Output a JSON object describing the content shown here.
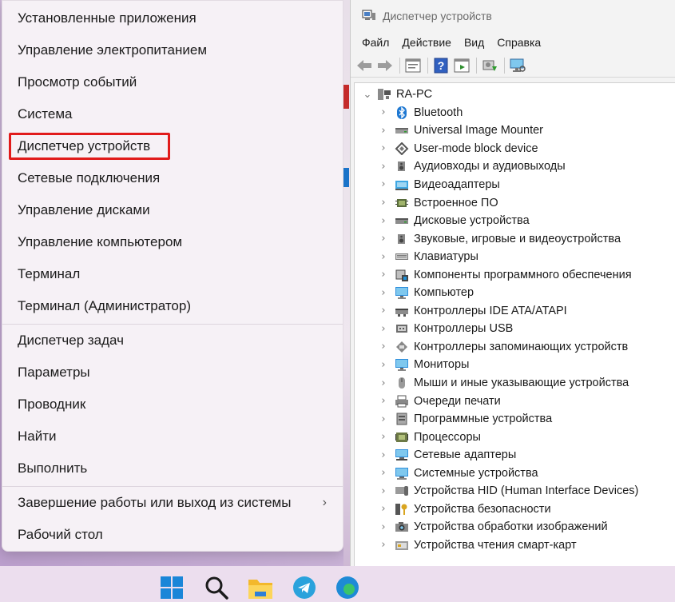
{
  "winx_menu": {
    "group1": [
      "Установленные приложения",
      "Управление электропитанием",
      "Просмотр событий",
      "Система",
      "Диспетчер устройств",
      "Сетевые подключения",
      "Управление дисками",
      "Управление компьютером",
      "Терминал",
      "Терминал (Администратор)"
    ],
    "group2": [
      "Диспетчер задач",
      "Параметры",
      "Проводник",
      "Найти",
      "Выполнить"
    ],
    "group3": [
      "Завершение работы или выход из системы",
      "Рабочий стол"
    ],
    "highlighted": "Диспетчер устройств",
    "submenu_glyph": "›",
    "highlight_color": "#e11b1b"
  },
  "device_manager": {
    "title": "Диспетчер устройств",
    "menus": [
      "Файл",
      "Действие",
      "Вид",
      "Справка"
    ],
    "toolbar_icons": [
      "back-arrow-icon",
      "forward-arrow-icon",
      "properties-icon",
      "help-icon",
      "view-icon",
      "update-driver-icon",
      "scan-hardware-icon"
    ],
    "root": "RA-PC",
    "expanded_glyph": "⌄",
    "collapsed_glyph": "›",
    "nodes": [
      {
        "label": "Bluetooth",
        "icon": "bluetooth-icon"
      },
      {
        "label": "Universal Image Mounter",
        "icon": "drive-icon"
      },
      {
        "label": "User-mode block device",
        "icon": "diamond-icon"
      },
      {
        "label": "Аудиовходы и аудиовыходы",
        "icon": "speaker-icon"
      },
      {
        "label": "Видеоадаптеры",
        "icon": "display-adapter-icon"
      },
      {
        "label": "Встроенное ПО",
        "icon": "chip-icon"
      },
      {
        "label": "Дисковые устройства",
        "icon": "disk-icon"
      },
      {
        "label": "Звуковые, игровые и видеоустройства",
        "icon": "speaker-icon"
      },
      {
        "label": "Клавиатуры",
        "icon": "keyboard-icon"
      },
      {
        "label": "Компоненты программного обеспечения",
        "icon": "software-component-icon"
      },
      {
        "label": "Компьютер",
        "icon": "monitor-icon"
      },
      {
        "label": "Контроллеры IDE ATA/ATAPI",
        "icon": "ide-icon"
      },
      {
        "label": "Контроллеры USB",
        "icon": "usb-icon"
      },
      {
        "label": "Контроллеры запоминающих устройств",
        "icon": "storage-controller-icon"
      },
      {
        "label": "Мониторы",
        "icon": "monitor-icon"
      },
      {
        "label": "Мыши и иные указывающие устройства",
        "icon": "mouse-icon"
      },
      {
        "label": "Очереди печати",
        "icon": "printer-icon"
      },
      {
        "label": "Программные устройства",
        "icon": "software-device-icon"
      },
      {
        "label": "Процессоры",
        "icon": "processor-icon"
      },
      {
        "label": "Сетевые адаптеры",
        "icon": "network-icon"
      },
      {
        "label": "Системные устройства",
        "icon": "system-device-icon"
      },
      {
        "label": "Устройства HID (Human Interface Devices)",
        "icon": "hid-icon"
      },
      {
        "label": "Устройства безопасности",
        "icon": "security-key-icon"
      },
      {
        "label": "Устройства обработки изображений",
        "icon": "camera-icon"
      },
      {
        "label": "Устройства чтения смарт-карт",
        "icon": "smartcard-icon"
      }
    ]
  },
  "taskbar": {
    "icons": [
      "windows-start-icon",
      "search-icon",
      "file-explorer-icon",
      "telegram-icon",
      "edge-icon"
    ]
  }
}
